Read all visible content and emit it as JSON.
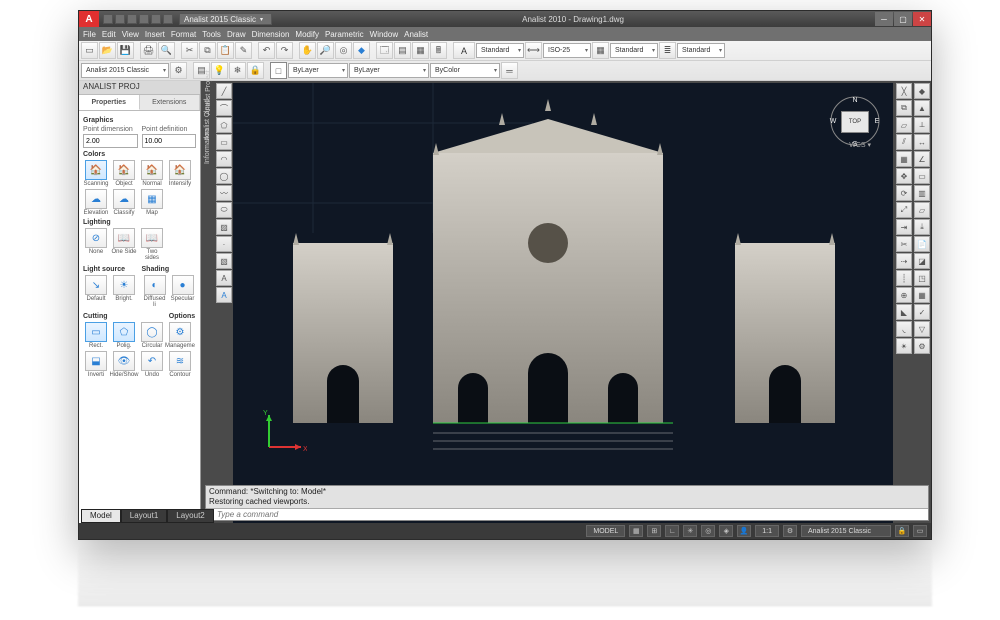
{
  "title": "Analist 2010 - Drawing1.dwg",
  "workspace": "Analist 2015 Classic",
  "menus": [
    "File",
    "Edit",
    "View",
    "Insert",
    "Format",
    "Tools",
    "Draw",
    "Dimension",
    "Modify",
    "Parametric",
    "Window",
    "Analist"
  ],
  "layer_drops": {
    "layer": "ByLayer",
    "linetype": "ByLayer",
    "color": "ByColor"
  },
  "style_drops": {
    "text": "Standard",
    "dim": "ISO-25",
    "table": "Standard",
    "ml": "Standard"
  },
  "ws_drop": "Analist 2015 Classic",
  "panel": {
    "title": "ANALIST PROJ",
    "tabs": [
      "Properties",
      "Extensions"
    ],
    "graphics": "Graphics",
    "point_dim_lbl": "Point dimension",
    "point_dim": "2.00",
    "point_def_lbl": "Point definition",
    "point_def": "10.00",
    "colors_lbl": "Colors",
    "color_items": [
      "Scanning",
      "Object",
      "Normal",
      "Intensify",
      "Elevation",
      "Classify",
      "Map"
    ],
    "lighting_lbl": "Lighting",
    "lighting_items": [
      "None",
      "One Side",
      "Two sides"
    ],
    "light_src_lbl": "Light source",
    "light_src_items": [
      "Default",
      "Bright."
    ],
    "shading_lbl": "Shading",
    "shading_items": [
      "Diffused li",
      "Specular"
    ],
    "cutting_lbl": "Cutting",
    "cutting_items": [
      "Rect.",
      "Polig.",
      "Circular",
      "Manageme"
    ],
    "options_lbl": "Options",
    "bottom_items": [
      "Inverti",
      "Hide/Show",
      "Undo",
      "Contour"
    ]
  },
  "vstrips": [
    "Analist Project",
    "Analist Cloud",
    "Information"
  ],
  "compass": {
    "n": "N",
    "s": "S",
    "e": "E",
    "w": "W",
    "cube": "TOP",
    "wcs": "WCS ▾"
  },
  "cmd": {
    "l1": "Command:   *Switching to: Model*",
    "l2": "Restoring cached viewports.",
    "prompt": "▸",
    "placeholder": "Type a command"
  },
  "tabs": [
    "Model",
    "Layout1",
    "Layout2"
  ],
  "status": {
    "mode": "MODEL",
    "scale": "1:1",
    "ws": "Analist 2015 Classic"
  }
}
